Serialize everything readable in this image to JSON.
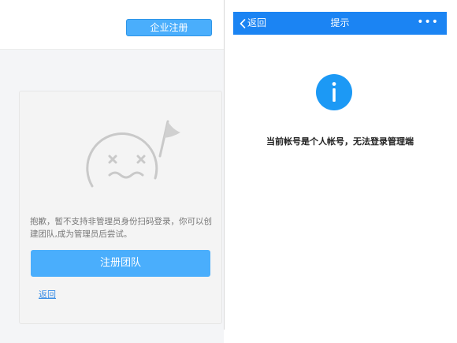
{
  "left_panel": {
    "enterprise_register_label": "企业注册",
    "message": "抱歉，暂不支持非管理员身份扫码登录，你可以创建团队,成为管理员后尝试。",
    "register_team_label": "注册团队",
    "back_link": "返回"
  },
  "right_panel": {
    "nav": {
      "back_label": "返回",
      "title": "提示",
      "more": "•••"
    },
    "notice": "当前帐号是个人帐号，无法登录管理端"
  },
  "colors": {
    "primary_blue": "#4aaefc",
    "nav_blue": "#1b84f3",
    "info_icon_blue": "#1c99f5"
  },
  "icons": {
    "sad_face": "sad-face-flag-icon",
    "back": "chevron-left-icon",
    "info": "info-icon"
  }
}
